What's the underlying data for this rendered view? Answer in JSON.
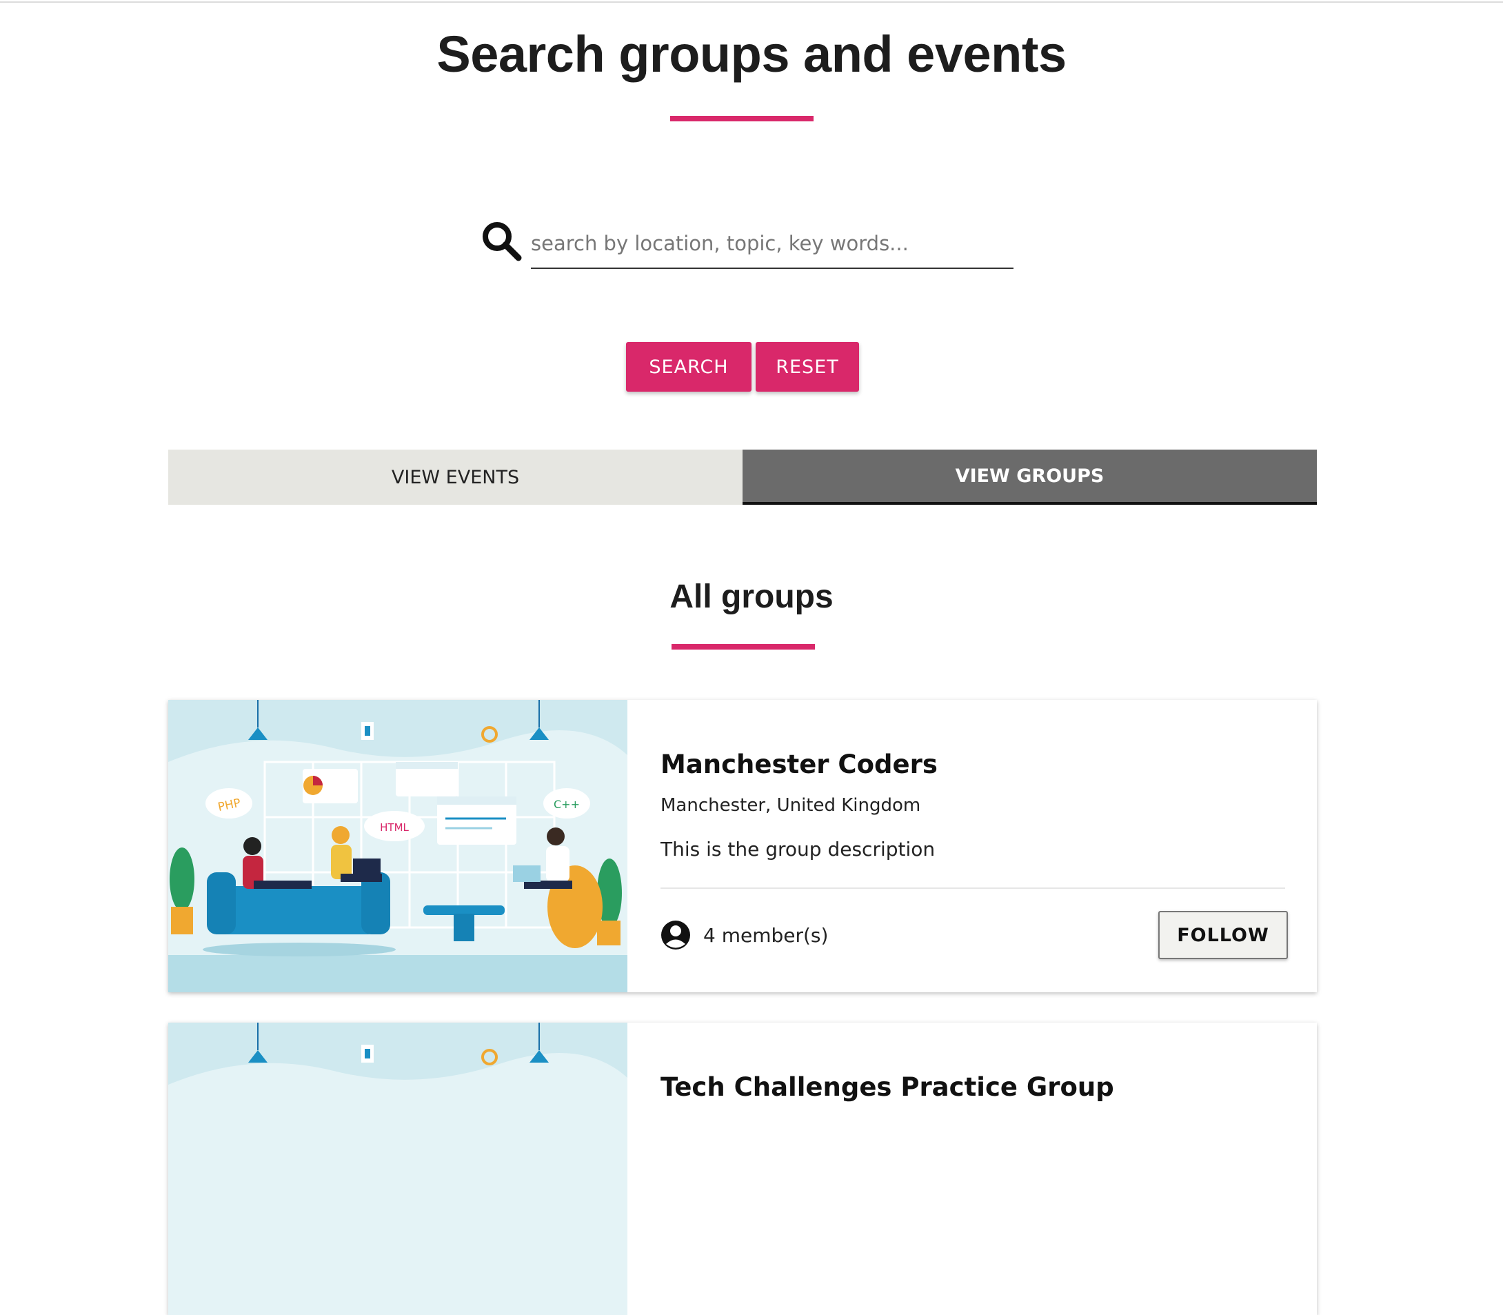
{
  "page": {
    "title": "Search groups and events",
    "accent_color": "#d9286a"
  },
  "search": {
    "icon": "search-icon",
    "placeholder": "search by location, topic, key words...",
    "value": "",
    "search_label": "SEARCH",
    "reset_label": "RESET"
  },
  "tabs": [
    {
      "label": "VIEW EVENTS",
      "active": false
    },
    {
      "label": "VIEW GROUPS",
      "active": true
    }
  ],
  "section": {
    "title": "All groups"
  },
  "groups": [
    {
      "name": "Manchester Coders",
      "location": "Manchester, United Kingdom",
      "description": "This is the group description",
      "members_icon": "person-circle-icon",
      "members": "4 member(s)",
      "follow_label": "FOLLOW",
      "image": "coworking-illustration",
      "illustration_labels": [
        "PHP",
        "HTML",
        "C++"
      ]
    },
    {
      "name": "Tech Challenges Practice Group",
      "image": "coworking-illustration"
    }
  ]
}
